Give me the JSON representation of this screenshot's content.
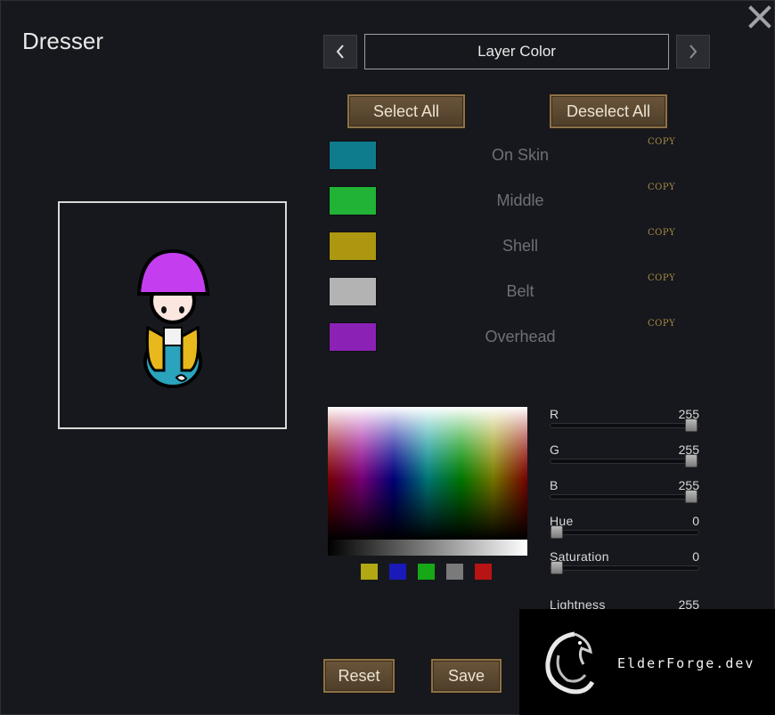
{
  "window": {
    "title": "Dresser"
  },
  "tab_nav": {
    "title": "Layer Color",
    "prev_icon": "chevron-left-icon",
    "next_icon": "chevron-right-icon"
  },
  "actions": {
    "select_all": "Select All",
    "deselect_all": "Deselect All",
    "reset": "Reset",
    "save": "Save"
  },
  "layers": [
    {
      "label": "On Skin",
      "color": "#0e7c8c",
      "copy": "COPY"
    },
    {
      "label": "Middle",
      "color": "#20b336",
      "copy": "COPY"
    },
    {
      "label": "Shell",
      "color": "#ad9610",
      "copy": "COPY"
    },
    {
      "label": "Belt",
      "color": "#b3b3b3",
      "copy": "COPY"
    },
    {
      "label": "Overhead",
      "color": "#8c22b5",
      "copy": "COPY"
    }
  ],
  "presets": [
    "#b1a814",
    "#1a1ab8",
    "#16a816",
    "#7a7a7a",
    "#b81414"
  ],
  "sliders": [
    {
      "label": "R",
      "value": "255",
      "level": 1.0
    },
    {
      "label": "G",
      "value": "255",
      "level": 1.0
    },
    {
      "label": "B",
      "value": "255",
      "level": 1.0
    },
    {
      "label": "Hue",
      "value": "0",
      "level": 0.0
    },
    {
      "label": "Saturation",
      "value": "0",
      "level": 0.0
    },
    {
      "label": "Lightness",
      "value": "255",
      "level": 1.0
    }
  ],
  "watermark": {
    "text": "ElderForge.dev"
  }
}
